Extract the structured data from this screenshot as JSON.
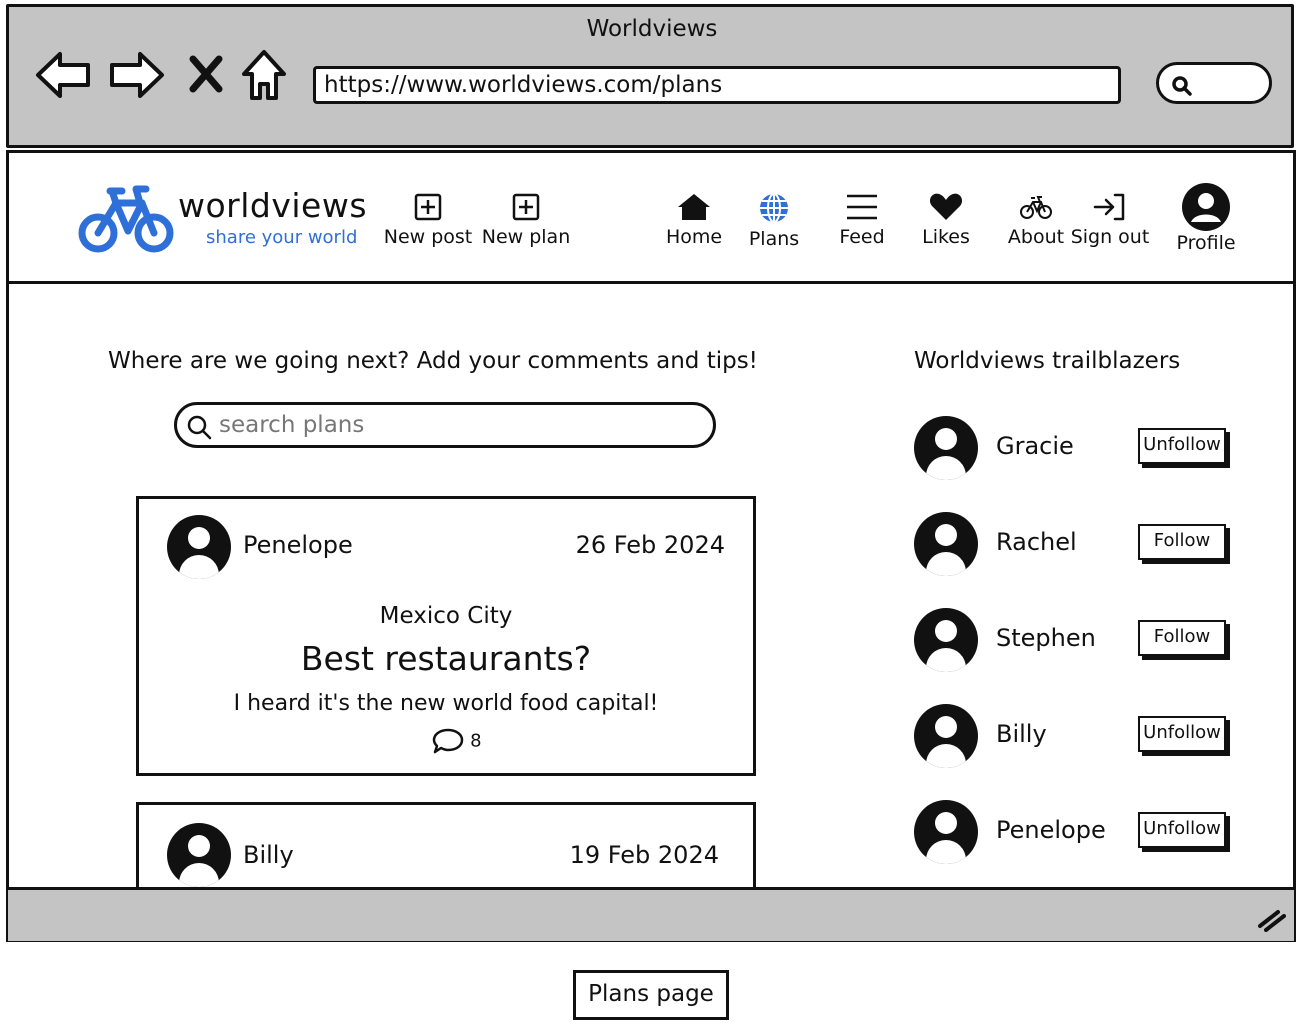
{
  "browser": {
    "window_title": "Worldviews",
    "url": "https://www.worldviews.com/plans"
  },
  "brand": {
    "name": "worldviews",
    "tagline": "share your world",
    "accent_color": "#2f6fd8"
  },
  "nav": {
    "new_post": "New post",
    "new_plan": "New plan",
    "home": "Home",
    "plans": "Plans",
    "feed": "Feed",
    "likes": "Likes",
    "about": "About",
    "sign_out": "Sign out",
    "profile": "Profile"
  },
  "main": {
    "heading": "Where are we going next? Add your comments and tips!",
    "search_placeholder": "search plans",
    "plans": [
      {
        "author": "Penelope",
        "date": "26 Feb 2024",
        "location": "Mexico City",
        "title": "Best restaurants?",
        "body": "I heard it's the new world food capital!",
        "comment_count": "8"
      },
      {
        "author": "Billy",
        "date": "19 Feb 2024"
      }
    ]
  },
  "sidebar": {
    "heading": "Worldviews trailblazers",
    "users": [
      {
        "name": "Gracie",
        "action": "Unfollow"
      },
      {
        "name": "Rachel",
        "action": "Follow"
      },
      {
        "name": "Stephen",
        "action": "Follow"
      },
      {
        "name": "Billy",
        "action": "Unfollow"
      },
      {
        "name": "Penelope",
        "action": "Unfollow"
      }
    ]
  },
  "caption": "Plans page"
}
